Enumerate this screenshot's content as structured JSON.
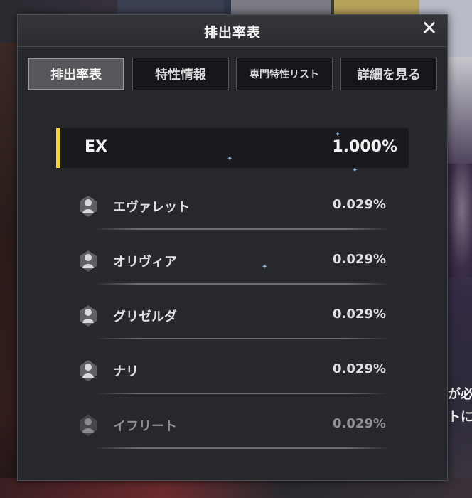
{
  "background": {
    "right_text_lines": [
      "が必ず",
      "トに"
    ]
  },
  "dialog": {
    "title": "排出率表",
    "close_icon": "close-icon"
  },
  "tabs": [
    {
      "label": "排出率表",
      "active": true
    },
    {
      "label": "特性情報",
      "active": false
    },
    {
      "label": "専門特性リスト",
      "active": false
    },
    {
      "label": "詳細を見る",
      "active": false
    }
  ],
  "rarity_group": {
    "label": "EX",
    "rate": "1.000%",
    "accent_color": "#f3d43b"
  },
  "characters": [
    {
      "name": "エヴァレット",
      "rate": "0.029%",
      "icon": "character-silhouette-icon"
    },
    {
      "name": "オリヴィア",
      "rate": "0.029%",
      "icon": "character-silhouette-icon"
    },
    {
      "name": "グリゼルダ",
      "rate": "0.029%",
      "icon": "character-silhouette-icon"
    },
    {
      "name": "ナリ",
      "rate": "0.029%",
      "icon": "character-silhouette-icon"
    },
    {
      "name": "イフリート",
      "rate": "0.029%",
      "icon": "character-silhouette-icon"
    }
  ]
}
